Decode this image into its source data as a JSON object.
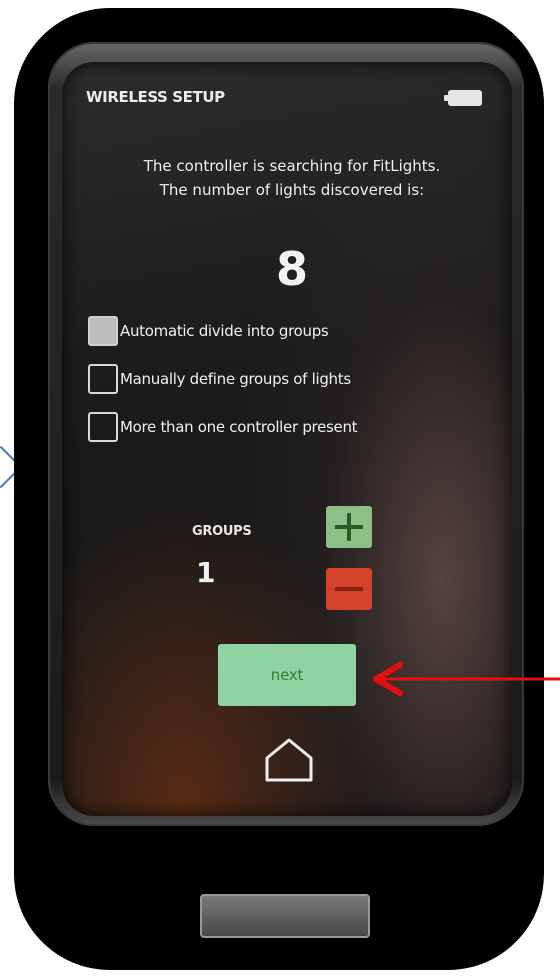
{
  "screen": {
    "title": "WIRELESS SETUP",
    "message_line1": "The controller is searching for FitLights.",
    "message_line2": "The number of lights discovered is:",
    "lights_discovered": "8"
  },
  "options": [
    {
      "label": "Automatic divide into groups",
      "checked": true
    },
    {
      "label": "Manually define groups of lights",
      "checked": false
    },
    {
      "label": "More than one controller present",
      "checked": false
    }
  ],
  "groups": {
    "label": "GROUPS",
    "value": "1"
  },
  "next_button": {
    "label": "next"
  },
  "colors": {
    "plus": "#8dbf86",
    "minus": "#d5432c",
    "next": "#8ed3a1",
    "arrow": "#e01010"
  },
  "icons": [
    "battery-icon",
    "plus-icon",
    "minus-icon",
    "home-icon",
    "red-arrow-annotation"
  ]
}
